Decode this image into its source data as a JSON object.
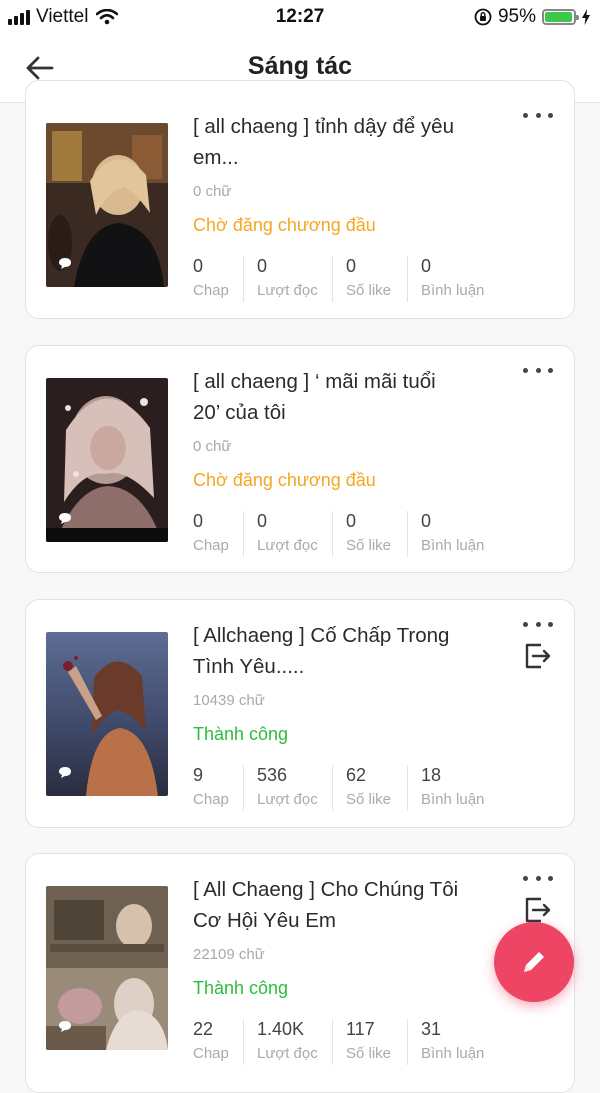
{
  "statusbar": {
    "carrier": "Viettel",
    "time": "12:27",
    "battery": "95%",
    "battery_level": 0.95
  },
  "header": {
    "title": "Sáng tác"
  },
  "stat_labels": {
    "chap": "Chap",
    "reads": "Lượt đọc",
    "likes": "Số like",
    "comments": "Bình luận"
  },
  "stories": [
    {
      "title_line1": "[ all chaeng ] tỉnh dậy để yêu",
      "title_line2": "em...",
      "words": "0 chữ",
      "status": "Chờ đăng chương đầu",
      "status_color": "#f5a623",
      "chap": "0",
      "reads": "0",
      "likes": "0",
      "comments": "0",
      "has_exit_icon": false
    },
    {
      "title_line1": "[ all chaeng ] ‘ mãi mãi tuổi",
      "title_line2": "20’ của tôi",
      "words": "0 chữ",
      "status": "Chờ đăng chương đầu",
      "status_color": "#f5a623",
      "chap": "0",
      "reads": "0",
      "likes": "0",
      "comments": "0",
      "has_exit_icon": false
    },
    {
      "title_line1": "[ Allchaeng ] Cố Chấp Trong",
      "title_line2": "Tình Yêu.....",
      "words": "10439 chữ",
      "status": "Thành công",
      "status_color": "#2dbd3c",
      "chap": "9",
      "reads": "536",
      "likes": "62",
      "comments": "18",
      "has_exit_icon": true
    },
    {
      "title_line1": "[ All Chaeng ] Cho Chúng Tôi",
      "title_line2": "Cơ Hội Yêu Em",
      "words": "22109 chữ",
      "status": "Thành công",
      "status_color": "#2dbd3c",
      "chap": "22",
      "reads": "1.40K",
      "likes": "117",
      "comments": "31",
      "has_exit_icon": true
    }
  ]
}
